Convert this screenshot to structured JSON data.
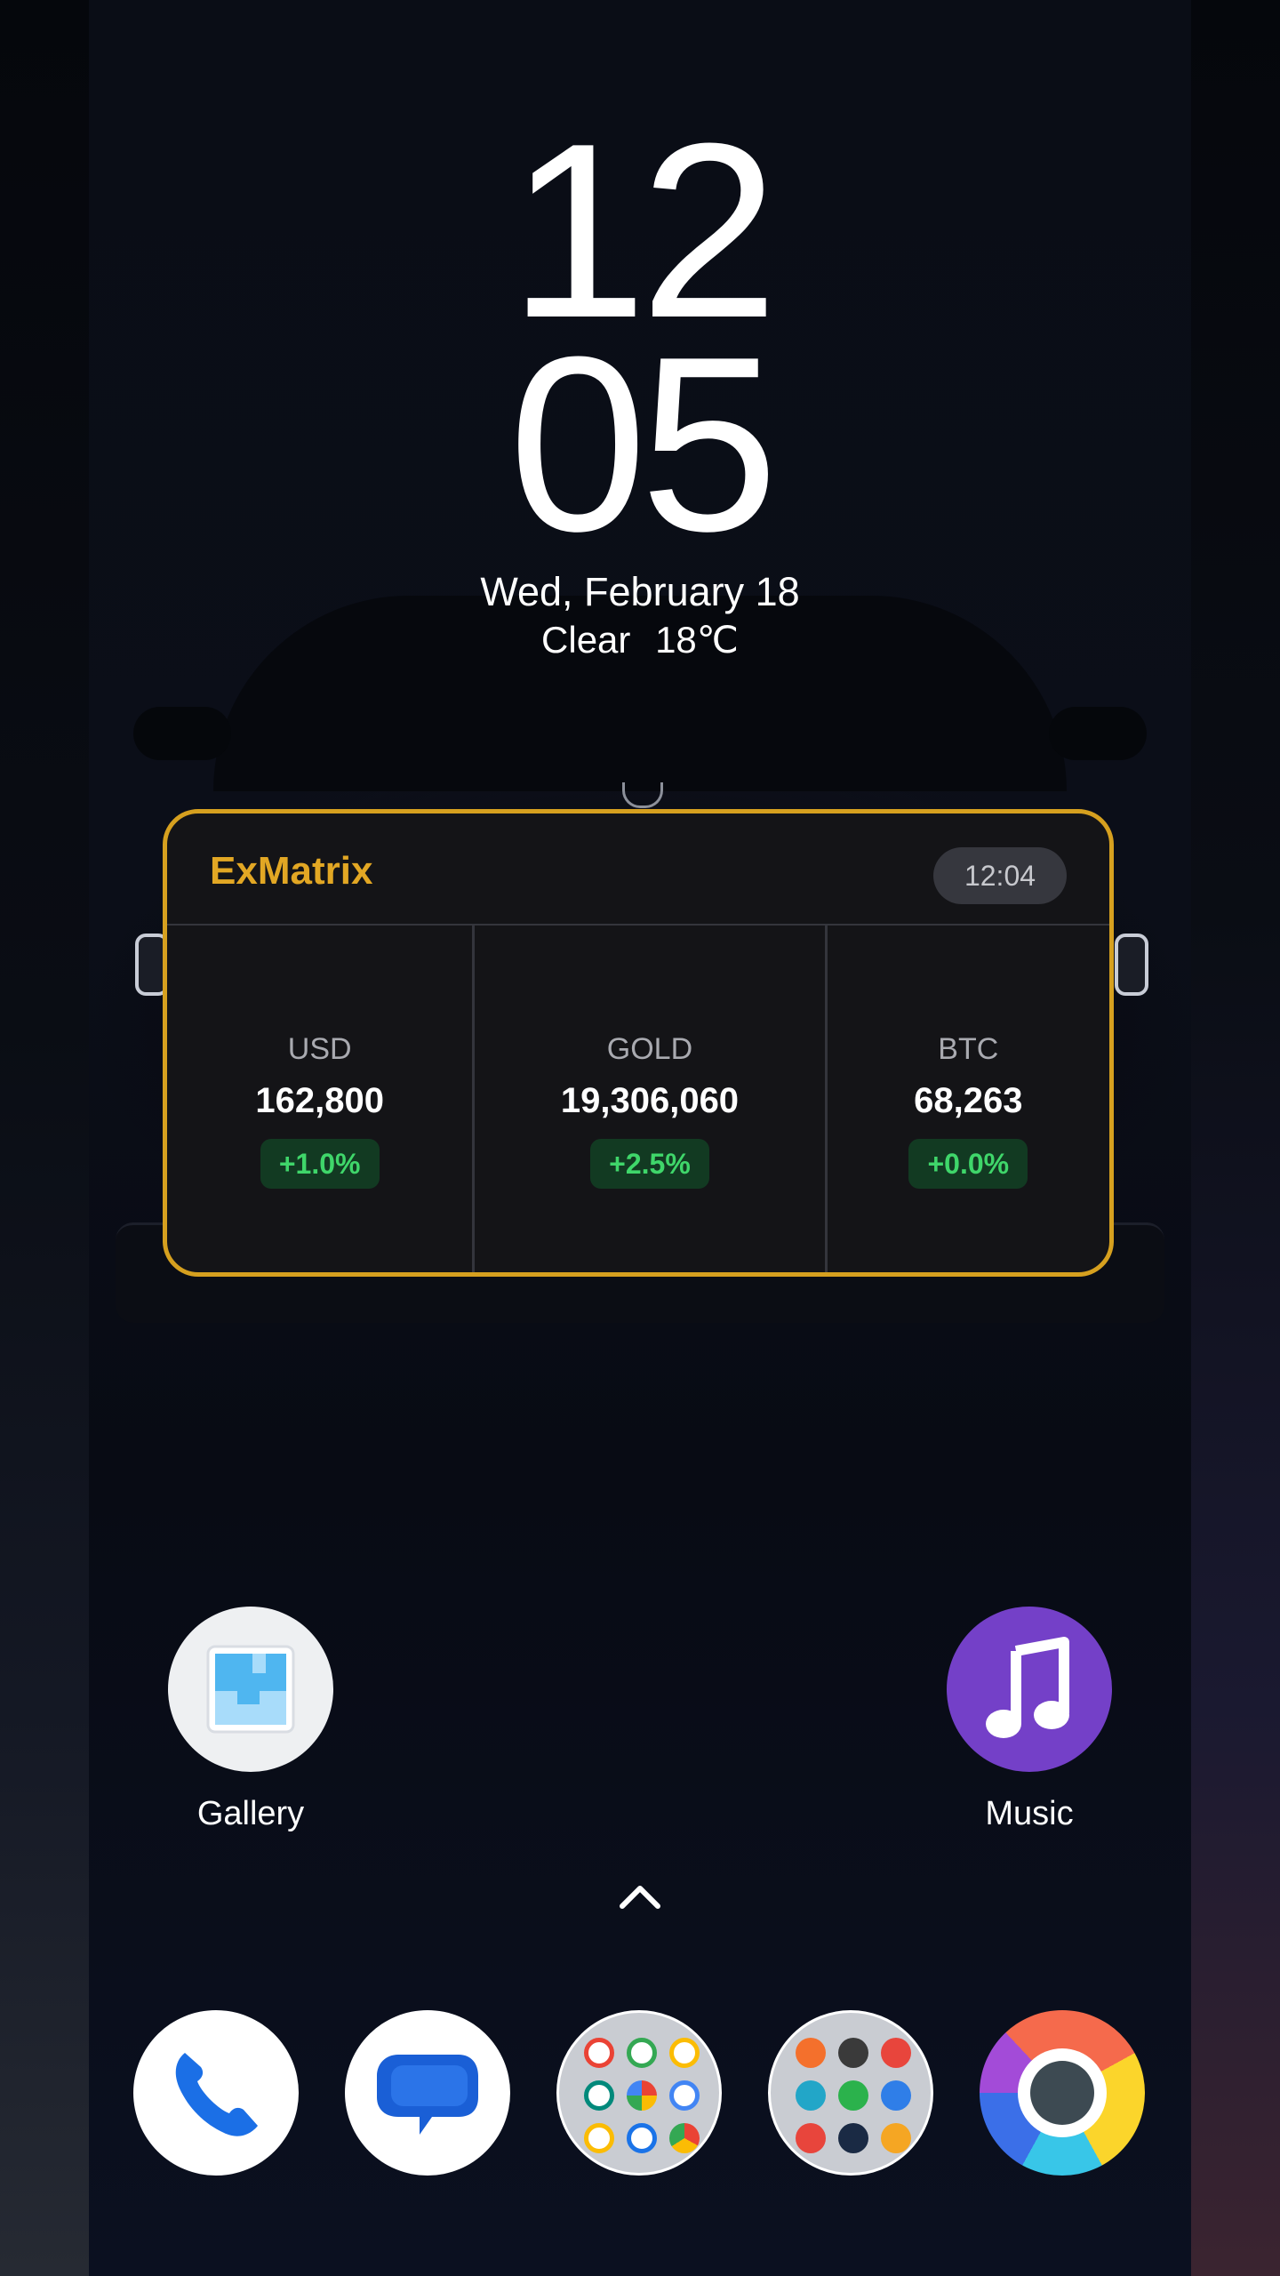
{
  "clock": {
    "hour": "12",
    "minute": "05"
  },
  "date": "Wed, February 18",
  "weather": {
    "condition": "Clear",
    "temperature": "18℃"
  },
  "widget": {
    "title": "ExMatrix",
    "updated": "12:04",
    "accent_color": "#d6a01f",
    "items": [
      {
        "name": "USD",
        "value": "162,800",
        "change": "+1.0%"
      },
      {
        "name": "GOLD",
        "value": "19,306,060",
        "change": "+2.5%"
      },
      {
        "name": "BTC",
        "value": "68,263",
        "change": "+0.0%"
      }
    ]
  },
  "home_apps": [
    {
      "label": "Gallery",
      "icon": "gallery-icon"
    },
    {
      "label": "Music",
      "icon": "music-note-icon"
    }
  ],
  "app_drawer": {
    "icon": "chevron-up-icon"
  },
  "dock": [
    {
      "icon": "phone-icon"
    },
    {
      "icon": "messages-icon"
    },
    {
      "icon": "google-apps-folder-icon"
    },
    {
      "icon": "tools-folder-icon"
    },
    {
      "icon": "chrome-icon"
    }
  ]
}
